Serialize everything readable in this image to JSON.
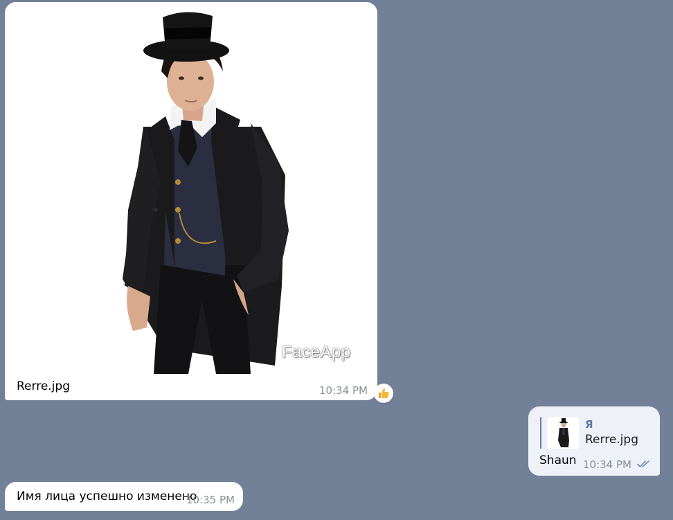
{
  "messages": {
    "photo": {
      "watermark": "FaceApp",
      "caption": "Rerre.jpg",
      "time": "10:34 PM",
      "reaction": "thumbs-up"
    },
    "reply": {
      "author": "Я",
      "filename": "Rerre.jpg",
      "text": "Shaun",
      "time": "10:34 PM",
      "status": "read"
    },
    "result": {
      "text": "Имя лица успешно изменено",
      "time": "10:35 PM"
    }
  },
  "colors": {
    "background": "#728197",
    "incoming_bubble": "#ffffff",
    "outgoing_bubble": "#eef1f8",
    "author": "#5a79aa",
    "timestamp": "#8a8f96"
  }
}
